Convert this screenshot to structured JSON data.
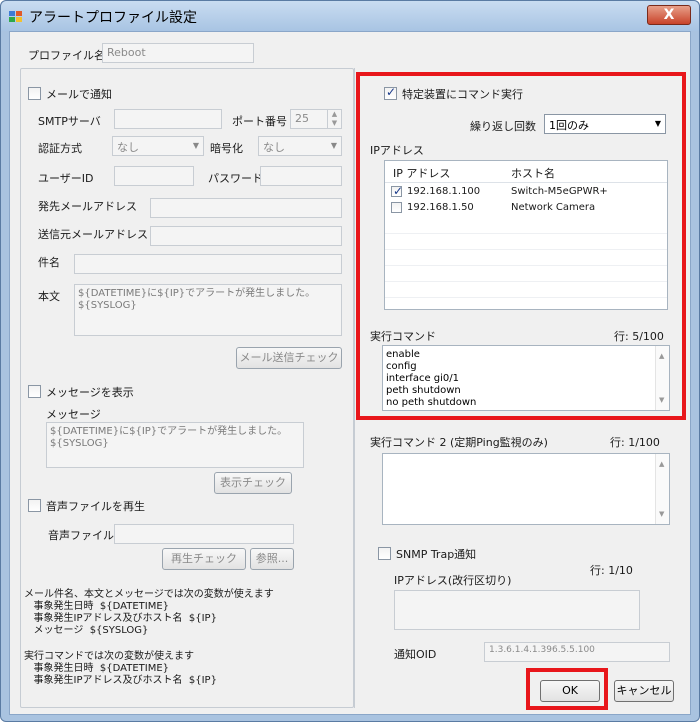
{
  "window": {
    "title": "アラートプロファイル設定",
    "close_label": "X"
  },
  "profile": {
    "label": "プロファイル名",
    "value": "Reboot"
  },
  "mail": {
    "section_label": "メールで通知",
    "smtp_label": "SMTPサーバ",
    "port_label": "ポート番号",
    "port_value": "25",
    "auth_label": "認証方式",
    "auth_value": "なし",
    "enc_label": "暗号化",
    "enc_value": "なし",
    "user_label": "ユーザーID",
    "pass_label": "パスワード",
    "to_label": "発先メールアドレス",
    "from_label": "送信元メールアドレス",
    "subject_label": "件名",
    "body_label": "本文",
    "body_line1": "${DATETIME}に${IP}でアラートが発生しました。",
    "body_line2": "${SYSLOG}",
    "check_button": "メール送信チェック"
  },
  "message": {
    "section_label": "メッセージを表示",
    "msg_label": "メッセージ",
    "msg_line1": "${DATETIME}に${IP}でアラートが発生しました。",
    "msg_line2": "${SYSLOG}",
    "check_button": "表示チェック"
  },
  "sound": {
    "section_label": "音声ファイルを再生",
    "file_label": "音声ファイル",
    "play_button": "再生チェック",
    "browse_button": "参照..."
  },
  "help": {
    "mail_vars": "メール件名、本文とメッセージでは次の変数が使えます\n   事象発生日時  ${DATETIME}\n   事象発生IPアドレス及びホスト名  ${IP}\n   メッセージ  ${SYSLOG}",
    "cmd_vars": "実行コマンドでは次の変数が使えます\n   事象発生日時  ${DATETIME}\n   事象発生IPアドレス及びホスト名  ${IP}"
  },
  "command": {
    "section_label": "特定装置にコマンド実行",
    "repeat_label": "繰り返し回数",
    "repeat_value": "1回のみ",
    "ip_group_label": "IPアドレス",
    "col_ip": "IP アドレス",
    "col_host": "ホスト名",
    "rows": [
      {
        "ip": "192.168.1.100",
        "host": "Switch-M5eGPWR+",
        "checked": true
      },
      {
        "ip": "192.168.1.50",
        "host": "Network Camera",
        "checked": false
      }
    ],
    "cmd_label": "実行コマンド",
    "cmd_lines_label": "行: 5/100",
    "cmd_lines": [
      "enable",
      "config",
      "interface gi0/1",
      "peth shutdown",
      "no peth shutdown"
    ],
    "cmd2_label": "実行コマンド 2 (定期Ping監視のみ)",
    "cmd2_lines_label": "行: 1/100"
  },
  "snmp": {
    "section_label": "SNMP Trap通知",
    "ip_label": "IPアドレス(改行区切り)",
    "lines_label": "行: 1/10",
    "oid_label": "通知OID",
    "oid_value": "1.3.6.1.4.1.396.5.5.100"
  },
  "footer": {
    "ok_label": "OK",
    "cancel_label": "キャンセル"
  },
  "colors": {
    "highlight": "#e8161b",
    "title_bar": "#a8c4e3"
  }
}
